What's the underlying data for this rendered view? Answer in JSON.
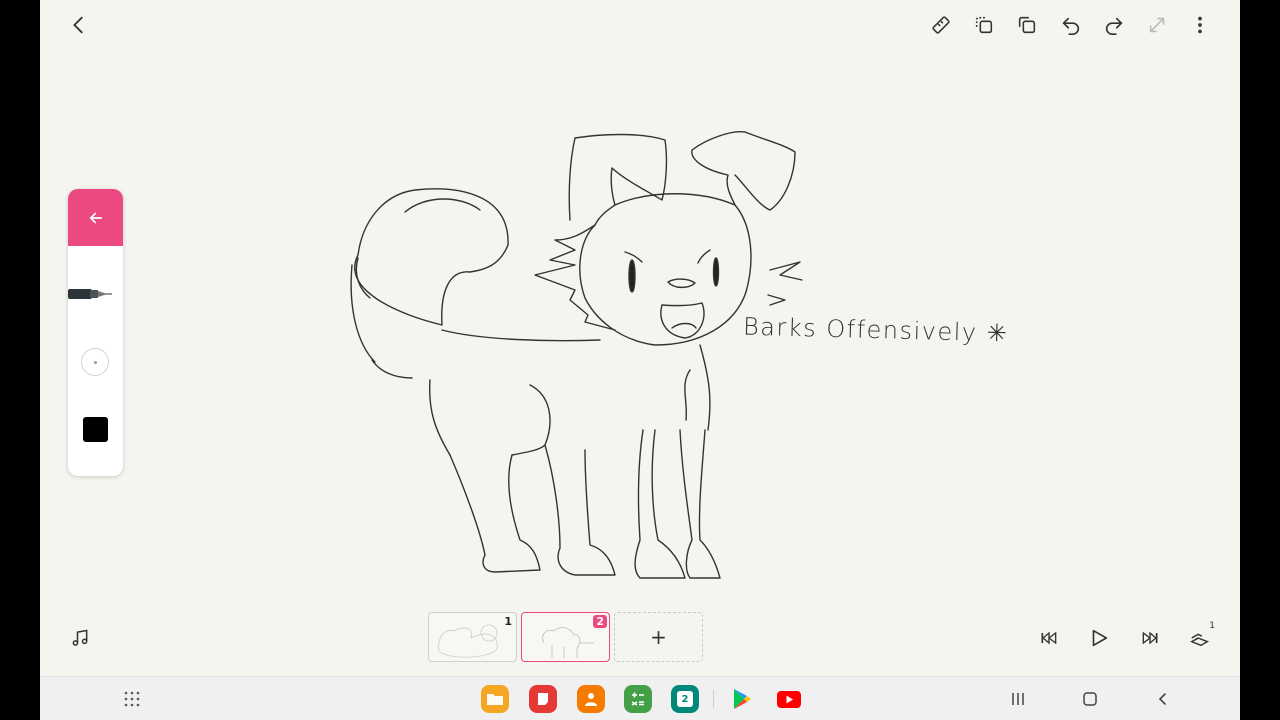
{
  "canvas": {
    "caption": "Barks Offensively",
    "caption_mark": "✳"
  },
  "top_toolbar": {
    "buttons": [
      "back",
      "ruler",
      "copy-frame",
      "duplicate",
      "undo",
      "redo",
      "fullscreen",
      "more"
    ]
  },
  "palette": {
    "collapse_icon": "arrow-left-icon",
    "pen_tool": "technical-pen",
    "size_indicator": "small",
    "current_color": "#000000"
  },
  "frames": [
    {
      "number": "1",
      "active": false
    },
    {
      "number": "2",
      "active": true
    }
  ],
  "add_frame_label": "+",
  "playback": {
    "music": "music-note-icon",
    "rewind": "skip-back-icon",
    "play": "play-icon",
    "forward": "skip-forward-icon",
    "onion": "onion-skin-icon",
    "onion_badge": "1"
  },
  "taskbar": {
    "calendar_day": "2",
    "apps": [
      "my-files",
      "notes",
      "contacts",
      "calculator",
      "calendar",
      "play-store",
      "youtube"
    ]
  },
  "colors": {
    "accent": "#ec4980",
    "background": "#f5f5ef"
  }
}
